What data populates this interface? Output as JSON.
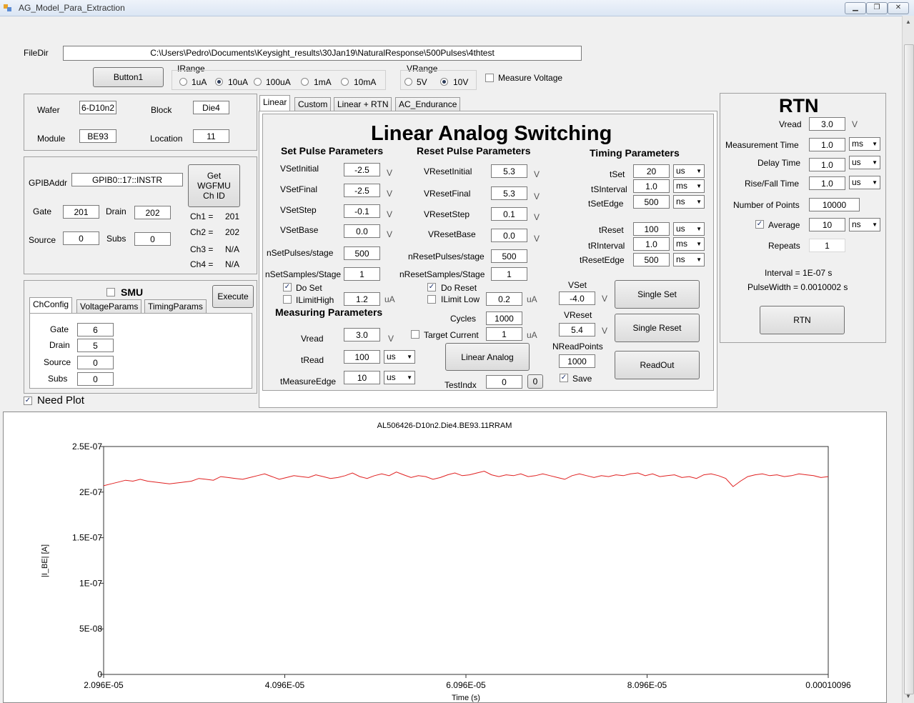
{
  "window": {
    "title": "AG_Model_Para_Extraction"
  },
  "filedir": {
    "label": "FileDir",
    "value": "C:\\Users\\Pedro\\Documents\\Keysight_results\\30Jan19\\NaturalResponse\\500Pulses\\4thtest"
  },
  "button1": "Button1",
  "irange": {
    "label": "IRange",
    "options": [
      "1uA",
      "10uA",
      "100uA",
      "1mA",
      "10mA"
    ],
    "selected": "10uA"
  },
  "vrange": {
    "label": "VRange",
    "options": [
      "5V",
      "10V"
    ],
    "selected": "10V"
  },
  "measure_voltage": "Measure Voltage",
  "device": {
    "wafer_label": "Wafer",
    "wafer": "6-D10n2",
    "block_label": "Block",
    "block": "Die4",
    "module_label": "Module",
    "module": "BE93",
    "location_label": "Location",
    "location": "11"
  },
  "gpib": {
    "label": "GPIBAddr",
    "value": "GPIB0::17::INSTR",
    "get_button": "Get WGFMU Ch ID",
    "gate_label": "Gate",
    "gate": "201",
    "drain_label": "Drain",
    "drain": "202",
    "source_label": "Source",
    "source": "0",
    "subs_label": "Subs",
    "subs": "0",
    "ch": [
      {
        "label": "Ch1 =",
        "value": "201"
      },
      {
        "label": "Ch2 =",
        "value": "202"
      },
      {
        "label": "Ch3 =",
        "value": "N/A"
      },
      {
        "label": "Ch4 =",
        "value": "N/A"
      }
    ]
  },
  "smu": {
    "label": "SMU",
    "execute": "Execute",
    "tabs": [
      "ChConfig",
      "VoltageParams",
      "TimingParams"
    ],
    "gate_label": "Gate",
    "gate": "6",
    "drain_label": "Drain",
    "drain": "5",
    "source_label": "Source",
    "source": "0",
    "subs_label": "Subs",
    "subs": "0"
  },
  "need_plot": "Need Plot",
  "main_tabs": [
    "Linear",
    "Custom",
    "Linear + RTN",
    "AC_Endurance"
  ],
  "linear": {
    "title": "Linear Analog Switching",
    "set_header": "Set Pulse Parameters",
    "reset_header": "Reset Pulse Parameters",
    "timing_header": "Timing Parameters",
    "measuring_header": "Measuring Parameters",
    "vset_initial_label": "VSetInitial",
    "vset_initial": "-2.5",
    "vset_final_label": "VSetFinal",
    "vset_final": "-2.5",
    "vset_step_label": "VSetStep",
    "vset_step": "-0.1",
    "vset_base_label": "VSetBase",
    "vset_base": "0.0",
    "nset_pulses_label": "nSetPulses/stage",
    "nset_pulses": "500",
    "nset_samples_label": "nSetSamples/Stage",
    "nset_samples": "1",
    "do_set": "Do Set",
    "ilimit_high_label": "ILimitHigh",
    "ilimit_high": "1.2",
    "vreset_initial_label": "VResetInitial",
    "vreset_initial": "5.3",
    "vreset_final_label": "VResetFinal",
    "vreset_final": "5.3",
    "vreset_step_label": "VResetStep",
    "vreset_step": "0.1",
    "vreset_base_label": "VResetBase",
    "vreset_base": "0.0",
    "nreset_pulses_label": "nResetPulses/stage",
    "nreset_pulses": "500",
    "nreset_samples_label": "nResetSamples/Stage",
    "nreset_samples": "1",
    "do_reset": "Do Reset",
    "ilimit_low_label": "ILimit Low",
    "ilimit_low": "0.2",
    "cycles_label": "Cycles",
    "cycles": "1000",
    "target_current_label": "Target Current",
    "target_current": "1",
    "tset_label": "tSet",
    "tset": "20",
    "tset_unit": "us",
    "tsinterval_label": "tSInterval",
    "tsinterval": "1.0",
    "tsinterval_unit": "ms",
    "tsetedge_label": "tSetEdge",
    "tsetedge": "500",
    "tsetedge_unit": "ns",
    "treset_label": "tReset",
    "treset": "100",
    "treset_unit": "us",
    "trinterval_label": "tRInterval",
    "trinterval": "1.0",
    "trinterval_unit": "ms",
    "tresetedge_label": "tResetEdge",
    "tresetedge": "500",
    "tresetedge_unit": "ns",
    "vread_label": "Vread",
    "vread": "3.0",
    "tread_label": "tRead",
    "tread": "100",
    "tread_unit": "us",
    "tmeasureedge_label": "tMeasureEdge",
    "tmeasureedge": "10",
    "tmeasureedge_unit": "us",
    "linear_analog_button": "Linear Analog",
    "testindx_label": "TestIndx",
    "testindx": "0",
    "testindx_button": "0",
    "vset_label": "VSet",
    "vset": "-4.0",
    "vreset_label": "VReset",
    "vreset": "5.4",
    "nreadpoints_label": "NReadPoints",
    "nreadpoints": "1000",
    "save": "Save",
    "single_set": "Single Set",
    "single_reset": "Single Reset",
    "readout": "ReadOut",
    "unit_v": "V",
    "unit_ua": "uA"
  },
  "rtn": {
    "title": "RTN",
    "vread_label": "Vread",
    "vread": "3.0",
    "vread_unit": "V",
    "meas_time_label": "Measurement Time",
    "meas_time": "1.0",
    "meas_time_unit": "ms",
    "delay_time_label": "Delay Time",
    "delay_time": "1.0",
    "delay_time_unit": "us",
    "rise_fall_label": "Rise/Fall Time",
    "rise_fall": "1.0",
    "rise_fall_unit": "us",
    "num_points_label": "Number of Points",
    "num_points": "10000",
    "average_label": "Average",
    "average": "10",
    "average_unit": "ns",
    "repeats_label": "Repeats",
    "repeats": "1",
    "interval_text": "Interval = 1E-07 s",
    "pulsewidth_text": "PulseWidth = 0.0010002 s",
    "rtn_button": "RTN"
  },
  "chart_data": {
    "type": "line",
    "title": "AL506426-D10n2.Die4.BE93.11RRAM",
    "xlabel": "Time (s)",
    "ylabel": "|I_BE| [A]",
    "xlim": [
      2.096e-05,
      0.00010096
    ],
    "ylim": [
      0,
      2.5e-07
    ],
    "x_ticks": [
      "2.096E-05",
      "4.096E-05",
      "6.096E-05",
      "8.096E-05",
      "0.00010096"
    ],
    "y_ticks": [
      "0",
      "5E-08",
      "1E-07",
      "1.5E-07",
      "2E-07",
      "2.5E-07"
    ],
    "series": [
      {
        "color": "#e02020",
        "x_start": 2.096e-05,
        "x_step": 1e-07,
        "values": [
          2.07e-07,
          2.09e-07,
          2.11e-07,
          2.13e-07,
          2.12e-07,
          2.14e-07,
          2.12e-07,
          2.11e-07,
          2.1e-07,
          2.09e-07,
          2.1e-07,
          2.11e-07,
          2.12e-07,
          2.15e-07,
          2.14e-07,
          2.13e-07,
          2.17e-07,
          2.16e-07,
          2.15e-07,
          2.14e-07,
          2.16e-07,
          2.18e-07,
          2.2e-07,
          2.17e-07,
          2.14e-07,
          2.16e-07,
          2.18e-07,
          2.17e-07,
          2.16e-07,
          2.19e-07,
          2.17e-07,
          2.15e-07,
          2.16e-07,
          2.18e-07,
          2.21e-07,
          2.17e-07,
          2.15e-07,
          2.18e-07,
          2.2e-07,
          2.18e-07,
          2.22e-07,
          2.19e-07,
          2.16e-07,
          2.18e-07,
          2.17e-07,
          2.14e-07,
          2.16e-07,
          2.19e-07,
          2.21e-07,
          2.18e-07,
          2.19e-07,
          2.21e-07,
          2.23e-07,
          2.19e-07,
          2.17e-07,
          2.19e-07,
          2.18e-07,
          2.2e-07,
          2.17e-07,
          2.18e-07,
          2.2e-07,
          2.18e-07,
          2.16e-07,
          2.14e-07,
          2.18e-07,
          2.2e-07,
          2.18e-07,
          2.16e-07,
          2.18e-07,
          2.17e-07,
          2.19e-07,
          2.18e-07,
          2.2e-07,
          2.21e-07,
          2.18e-07,
          2.2e-07,
          2.17e-07,
          2.18e-07,
          2.19e-07,
          2.16e-07,
          2.17e-07,
          2.15e-07,
          2.19e-07,
          2.2e-07,
          2.18e-07,
          2.15e-07,
          2.06e-07,
          2.12e-07,
          2.17e-07,
          2.19e-07,
          2.2e-07,
          2.18e-07,
          2.19e-07,
          2.17e-07,
          2.18e-07,
          2.2e-07,
          2.19e-07,
          2.18e-07,
          2.16e-07,
          2.17e-07
        ]
      }
    ]
  }
}
